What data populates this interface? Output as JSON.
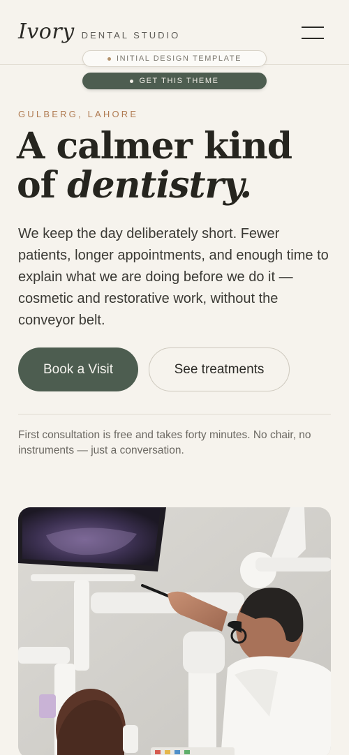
{
  "header": {
    "logo": "Ivory",
    "logo_sub": "DENTAL STUDIO",
    "menu_icon": "hamburger-menu-icon"
  },
  "banner": {
    "template_label": "INITIAL DESIGN TEMPLATE",
    "theme_button": "GET THIS THEME"
  },
  "hero": {
    "eyebrow": "GULBERG, LAHORE",
    "headline_line1": "A calmer kind",
    "headline_of": "of",
    "headline_em": "dentistry.",
    "lede": "We keep the day deliberately short. Fewer patients, longer appointments, and enough time to explain what we are doing before we do it — cosmetic and restorative work, without the conveyor belt.",
    "primary_cta": "Book a Visit",
    "secondary_cta": "See treatments",
    "note": "First consultation is free and takes forty minutes. No chair, no instruments — just a conversation."
  },
  "colors": {
    "background": "#f6f3ed",
    "accent_green": "#4d5d50",
    "accent_copper": "#b07b52",
    "text": "#2b2a26"
  }
}
